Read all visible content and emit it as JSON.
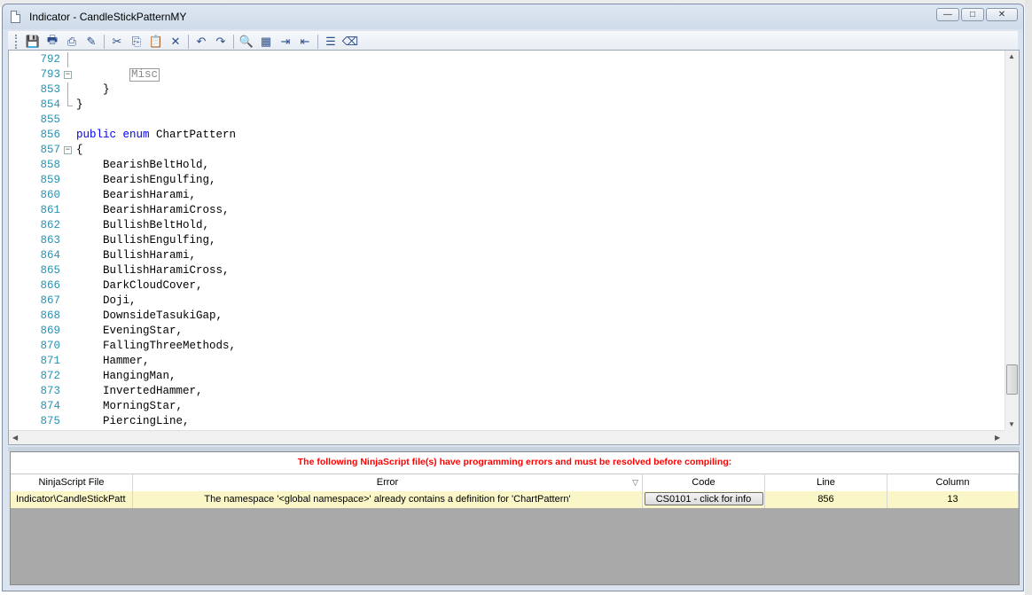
{
  "window": {
    "title": "Indicator - CandleStickPatternMY",
    "minimize": "—",
    "maximize": "□",
    "close": "✕"
  },
  "toolbar": {
    "icons": [
      "save-icon",
      "print-icon",
      "print-preview-icon",
      "page-setup-icon",
      "cut-icon",
      "copy-icon",
      "paste-icon",
      "delete-icon",
      "undo-icon",
      "redo-icon",
      "find-icon",
      "find-replace-icon",
      "indent-icon",
      "outdent-icon",
      "comment-icon",
      "uncomment-icon"
    ],
    "glyphs": [
      "💾",
      "🖶",
      "⎙",
      "✎",
      "✂",
      "⎘",
      "📋",
      "✕",
      "↶",
      "↷",
      "🔍",
      "▦",
      "⇥",
      "⇤",
      "☰",
      "⌫"
    ]
  },
  "editor": {
    "lines": [
      {
        "num": "792",
        "code": ""
      },
      {
        "num": "793",
        "code": "        ",
        "misc": "Misc"
      },
      {
        "num": "853",
        "code": "    }"
      },
      {
        "num": "854",
        "code": "}"
      },
      {
        "num": "855",
        "code": ""
      },
      {
        "num": "856",
        "kw": "public enum",
        "code": " ChartPattern"
      },
      {
        "num": "857",
        "code": "{"
      },
      {
        "num": "858",
        "code": "    BearishBeltHold,"
      },
      {
        "num": "859",
        "code": "    BearishEngulfing,"
      },
      {
        "num": "860",
        "code": "    BearishHarami,"
      },
      {
        "num": "861",
        "code": "    BearishHaramiCross,"
      },
      {
        "num": "862",
        "code": "    BullishBeltHold,"
      },
      {
        "num": "863",
        "code": "    BullishEngulfing,"
      },
      {
        "num": "864",
        "code": "    BullishHarami,"
      },
      {
        "num": "865",
        "code": "    BullishHaramiCross,"
      },
      {
        "num": "866",
        "code": "    DarkCloudCover,"
      },
      {
        "num": "867",
        "code": "    Doji,"
      },
      {
        "num": "868",
        "code": "    DownsideTasukiGap,"
      },
      {
        "num": "869",
        "code": "    EveningStar,"
      },
      {
        "num": "870",
        "code": "    FallingThreeMethods,"
      },
      {
        "num": "871",
        "code": "    Hammer,"
      },
      {
        "num": "872",
        "code": "    HangingMan,"
      },
      {
        "num": "873",
        "code": "    InvertedHammer,"
      },
      {
        "num": "874",
        "code": "    MorningStar,"
      },
      {
        "num": "875",
        "code": "    PiercingLine,"
      }
    ]
  },
  "errors": {
    "header": "The following NinjaScript file(s) have programming errors and must be resolved before compiling:",
    "columns": [
      "NinjaScript File",
      "Error",
      "Code",
      "Line",
      "Column"
    ],
    "rows": [
      {
        "file": "Indicator\\CandleStickPatt",
        "error": "The namespace '<global namespace>' already contains a definition for 'ChartPattern'",
        "code": "CS0101 - click for info",
        "line": "856",
        "column": "13"
      }
    ]
  },
  "colors": {
    "line_numbers": "#2b91af",
    "keyword": "#0000ff",
    "error_header": "#ff0000",
    "row_highlight": "#faf6c8"
  }
}
